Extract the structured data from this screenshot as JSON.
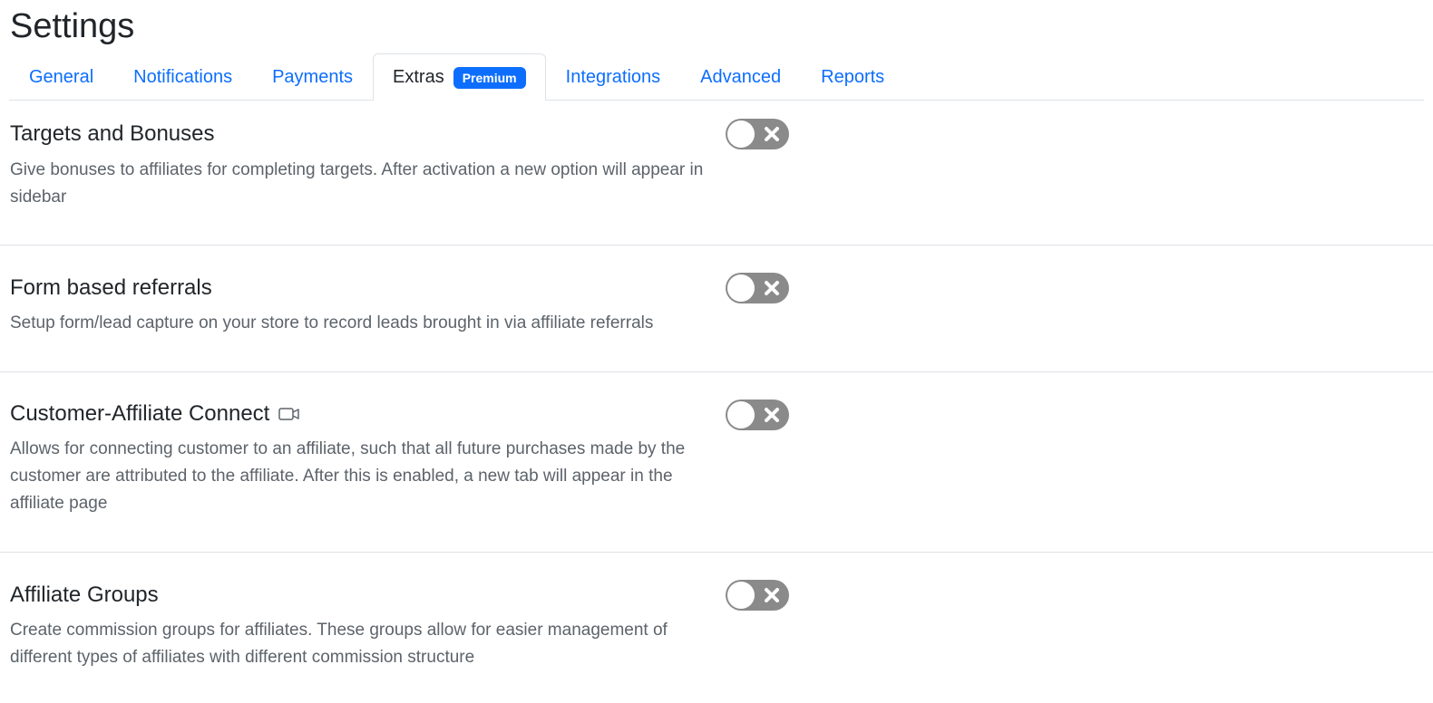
{
  "page": {
    "title": "Settings"
  },
  "tabs": [
    {
      "label": "General",
      "active": false
    },
    {
      "label": "Notifications",
      "active": false
    },
    {
      "label": "Payments",
      "active": false
    },
    {
      "label": "Extras",
      "active": true,
      "badge": "Premium"
    },
    {
      "label": "Integrations",
      "active": false
    },
    {
      "label": "Advanced",
      "active": false
    },
    {
      "label": "Reports",
      "active": false
    }
  ],
  "colors": {
    "accent": "#0d6efd",
    "toggle_off": "#8a8a8a",
    "divider": "#dee2e6"
  },
  "sections": [
    {
      "title": "Targets and Bonuses",
      "description": "Give bonuses to affiliates for completing targets. After activation a new option will appear in sidebar",
      "enabled": false
    },
    {
      "title": "Form based referrals",
      "description": "Setup form/lead capture on your store to record leads brought in via affiliate referrals",
      "enabled": false
    },
    {
      "title": "Customer-Affiliate Connect",
      "icon": "video-icon",
      "description": "Allows for connecting customer to an affiliate, such that all future purchases made by the customer are attributed to the affiliate. After this is enabled, a new tab will appear in the affiliate page",
      "enabled": false
    },
    {
      "title": "Affiliate Groups",
      "description": "Create commission groups for affiliates. These groups allow for easier management of different types of affiliates with different commission structure",
      "enabled": false
    }
  ]
}
